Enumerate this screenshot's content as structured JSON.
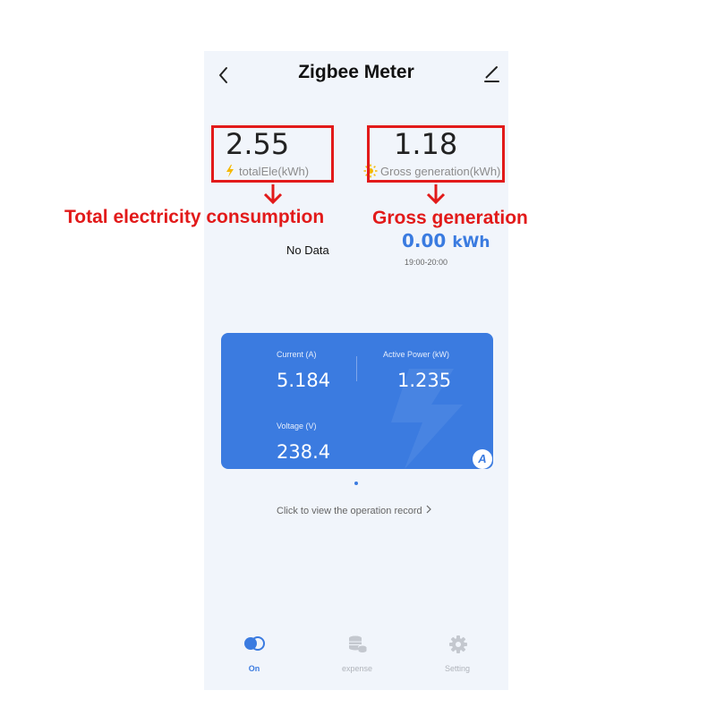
{
  "header": {
    "title": "Zigbee Meter",
    "back_icon": "chevron-left-icon",
    "edit_icon": "pencil-icon"
  },
  "stats": {
    "total": {
      "value": "2.55",
      "label": "totalEle(kWh)",
      "icon": "lightning-icon"
    },
    "gross": {
      "value": "1.18",
      "label": "Gross generation(kWh)",
      "icon": "sun-icon"
    }
  },
  "annotations": {
    "total": "Total electricity consumption",
    "gross": "Gross generation",
    "color": "#e21a1a"
  },
  "chart_area": {
    "no_data": "No Data"
  },
  "generation": {
    "value": "0.00",
    "unit": "kWh",
    "time": "19:00-20:00"
  },
  "card": {
    "current_label": "Current (A)",
    "current_value": "5.184",
    "power_label": "Active Power (kW)",
    "power_value": "1.235",
    "voltage_label": "Voltage (V)",
    "voltage_value": "238.4",
    "badge": "A",
    "color": "#3b7be0"
  },
  "record_link": "Click to view the operation record",
  "nav": [
    {
      "label": "On",
      "icon": "toggle-icon",
      "active": true
    },
    {
      "label": "expense",
      "icon": "coins-icon",
      "active": false
    },
    {
      "label": "Setting",
      "icon": "gear-icon",
      "active": false
    }
  ]
}
